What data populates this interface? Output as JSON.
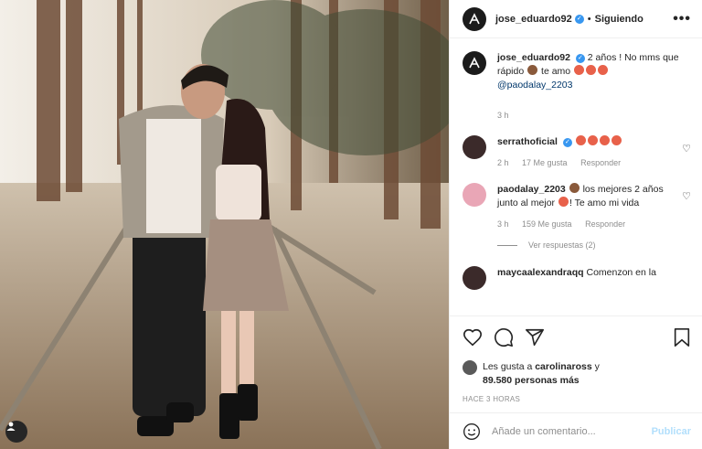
{
  "header": {
    "username": "jose_eduardo92",
    "verified_mark": "✓",
    "separator": "•",
    "follow_label": "Siguiendo",
    "more_label": "•••"
  },
  "caption": {
    "username": "jose_eduardo92",
    "text_1": "2 años ! No mms que rápido",
    "text_2": "te amo",
    "mention": "@paodalay_2203",
    "time": "3 h"
  },
  "comments": [
    {
      "username": "serrathoficial",
      "time": "2 h",
      "likes": "17 Me gusta",
      "reply_label": "Responder"
    },
    {
      "username": "paodalay_2203",
      "text_1": "los mejores 2 años junto al mejor",
      "text_2": "! Te amo mi vida",
      "time": "3 h",
      "likes": "159 Me gusta",
      "reply_label": "Responder",
      "view_replies": "Ver respuestas (2)"
    },
    {
      "username": "maycaalexandraqq",
      "text": "Comenzon en la"
    }
  ],
  "actions": {
    "icons": [
      "heart-icon",
      "comment-icon",
      "share-icon",
      "bookmark-icon"
    ]
  },
  "likes": {
    "prefix": "Les gusta a",
    "user": "carolinaross",
    "suffix": "y",
    "count": "89.580 personas más"
  },
  "timestamp": "HACE 3 HORAS",
  "add_comment": {
    "placeholder": "Añade un comentario...",
    "publish_label": "Publicar"
  },
  "colors": {
    "verified": "#3897f0",
    "link": "#00376b",
    "publish_disabled": "#b2dffc",
    "muted": "#8e8e8e"
  }
}
